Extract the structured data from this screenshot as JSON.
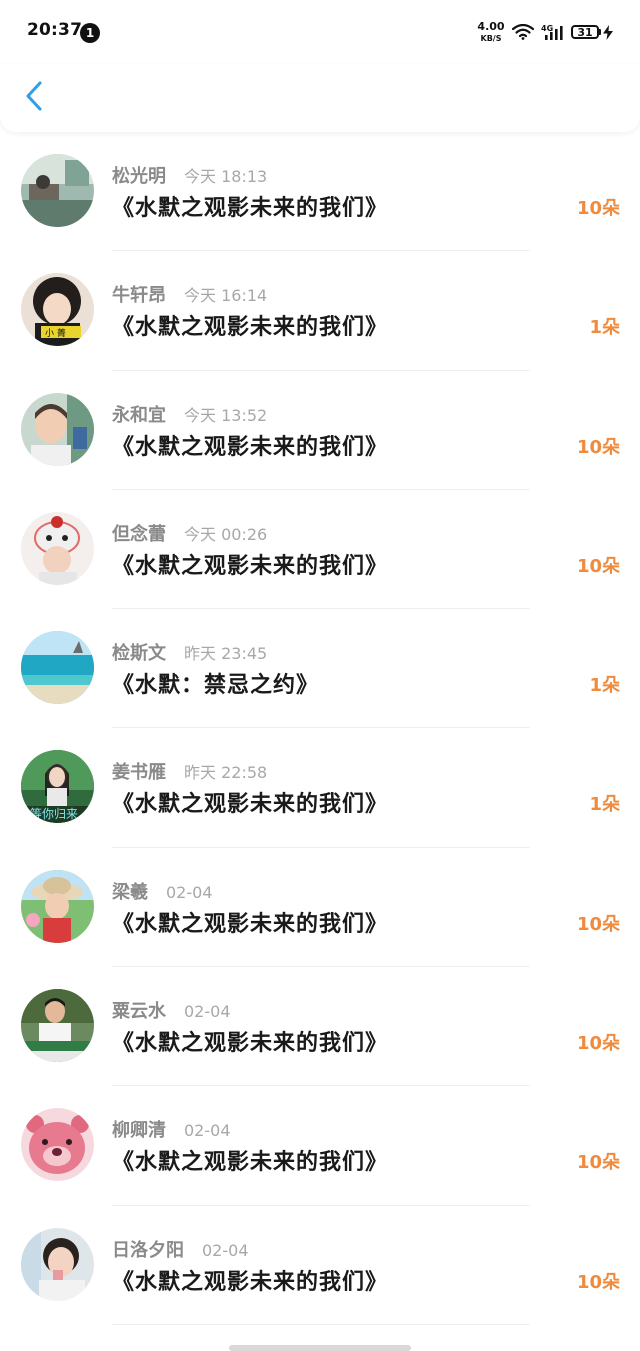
{
  "status_bar": {
    "time": "20:37",
    "notification_count": "1",
    "net_speed_value": "4.00",
    "net_speed_unit": "KB/S",
    "network_type": "4G",
    "battery": "31"
  },
  "colors": {
    "accent": "#2f9de8",
    "amount": "#f08a3c",
    "name": "#8a8a8a",
    "time": "#a8a8a8",
    "title": "#1a1a1a"
  },
  "nav": {
    "back_icon": "chevron-left-icon"
  },
  "items": [
    {
      "name": "松光明",
      "time": "今天 18:13",
      "title": "《水默之观影未来的我们》",
      "amount": "10朵"
    },
    {
      "name": "牛轩昂",
      "time": "今天 16:14",
      "title": "《水默之观影未来的我们》",
      "amount": "1朵"
    },
    {
      "name": "永和宜",
      "time": "今天 13:52",
      "title": "《水默之观影未来的我们》",
      "amount": "10朵"
    },
    {
      "name": "但念蕾",
      "time": "今天 00:26",
      "title": "《水默之观影未来的我们》",
      "amount": "10朵"
    },
    {
      "name": "检斯文",
      "time": "昨天 23:45",
      "title": "《水默：禁忌之约》",
      "amount": "1朵"
    },
    {
      "name": "姜书雁",
      "time": "昨天 22:58",
      "title": "《水默之观影未来的我们》",
      "amount": "1朵"
    },
    {
      "name": "梁羲",
      "time": "02-04",
      "title": "《水默之观影未来的我们》",
      "amount": "10朵"
    },
    {
      "name": "粟云水",
      "time": "02-04",
      "title": "《水默之观影未来的我们》",
      "amount": "10朵"
    },
    {
      "name": "柳卿清",
      "time": "02-04",
      "title": "《水默之观影未来的我们》",
      "amount": "10朵"
    },
    {
      "name": "日洛夕阳",
      "time": "02-04",
      "title": "《水默之观影未来的我们》",
      "amount": "10朵"
    }
  ],
  "avatar_captions": {
    "item_1": "小 菁",
    "item_5": "等你归来"
  }
}
